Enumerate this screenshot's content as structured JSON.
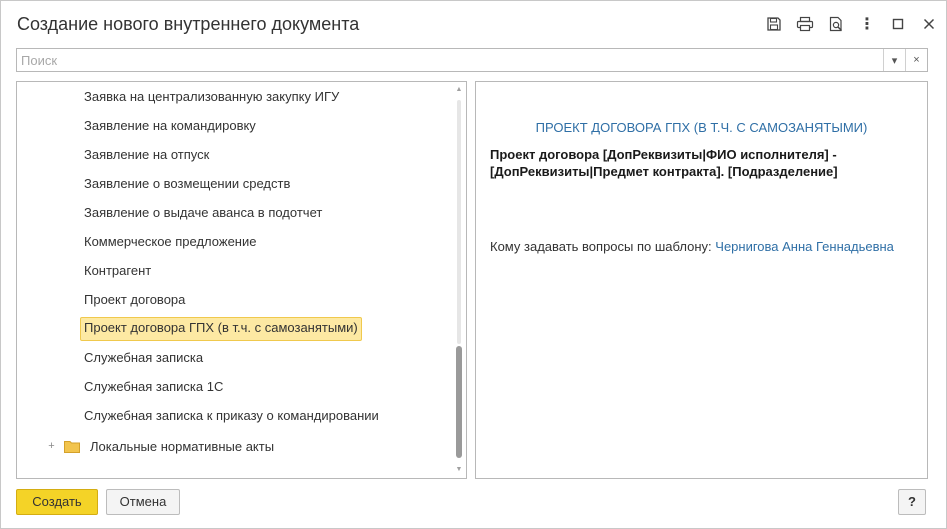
{
  "window": {
    "title": "Создание нового внутреннего документа",
    "icons": [
      "save-icon",
      "print-icon",
      "preview-icon",
      "more-icon",
      "maximize-icon",
      "close-icon"
    ],
    "more_glyph": "⋮",
    "maximize_glyph": "☐",
    "close_glyph": "✕"
  },
  "search": {
    "placeholder": "Поиск",
    "value": "",
    "dropdown_glyph": "▾",
    "clear_glyph": "×"
  },
  "tree": {
    "items": [
      "Заявка на централизованную закупку ИГУ",
      "Заявление на командировку",
      "Заявление на отпуск",
      "Заявление о возмещении средств",
      "Заявление о выдаче аванса в подотчет",
      "Коммерческое предложение",
      "Контрагент",
      "Проект договора",
      "Проект договора ГПХ (в т.ч. с самозанятыми)",
      "Служебная записка",
      "Служебная записка 1С",
      "Служебная записка к приказу о командировании"
    ],
    "selected_index": 8,
    "folder": {
      "label": "Локальные нормативные акты",
      "expander_glyph": "+"
    }
  },
  "preview": {
    "heading": "ПРОЕКТ ДОГОВОРА ГПХ (В Т.Ч. С САМОЗАНЯТЫМИ)",
    "description": "Проект договора [ДопРеквизиты|ФИО исполнителя] - [ДопРеквизиты|Предмет контракта]. [Подразделение]",
    "questions_label": "Кому задавать вопросы по шаблону:",
    "questions_contact": "Чернигова Анна Геннадьевна"
  },
  "buttons": {
    "create": "Создать",
    "cancel": "Отмена",
    "help": "?"
  },
  "colors": {
    "accent_button": "#f4d327",
    "selection_bg": "#fde9a3",
    "link": "#2f6fa6"
  }
}
